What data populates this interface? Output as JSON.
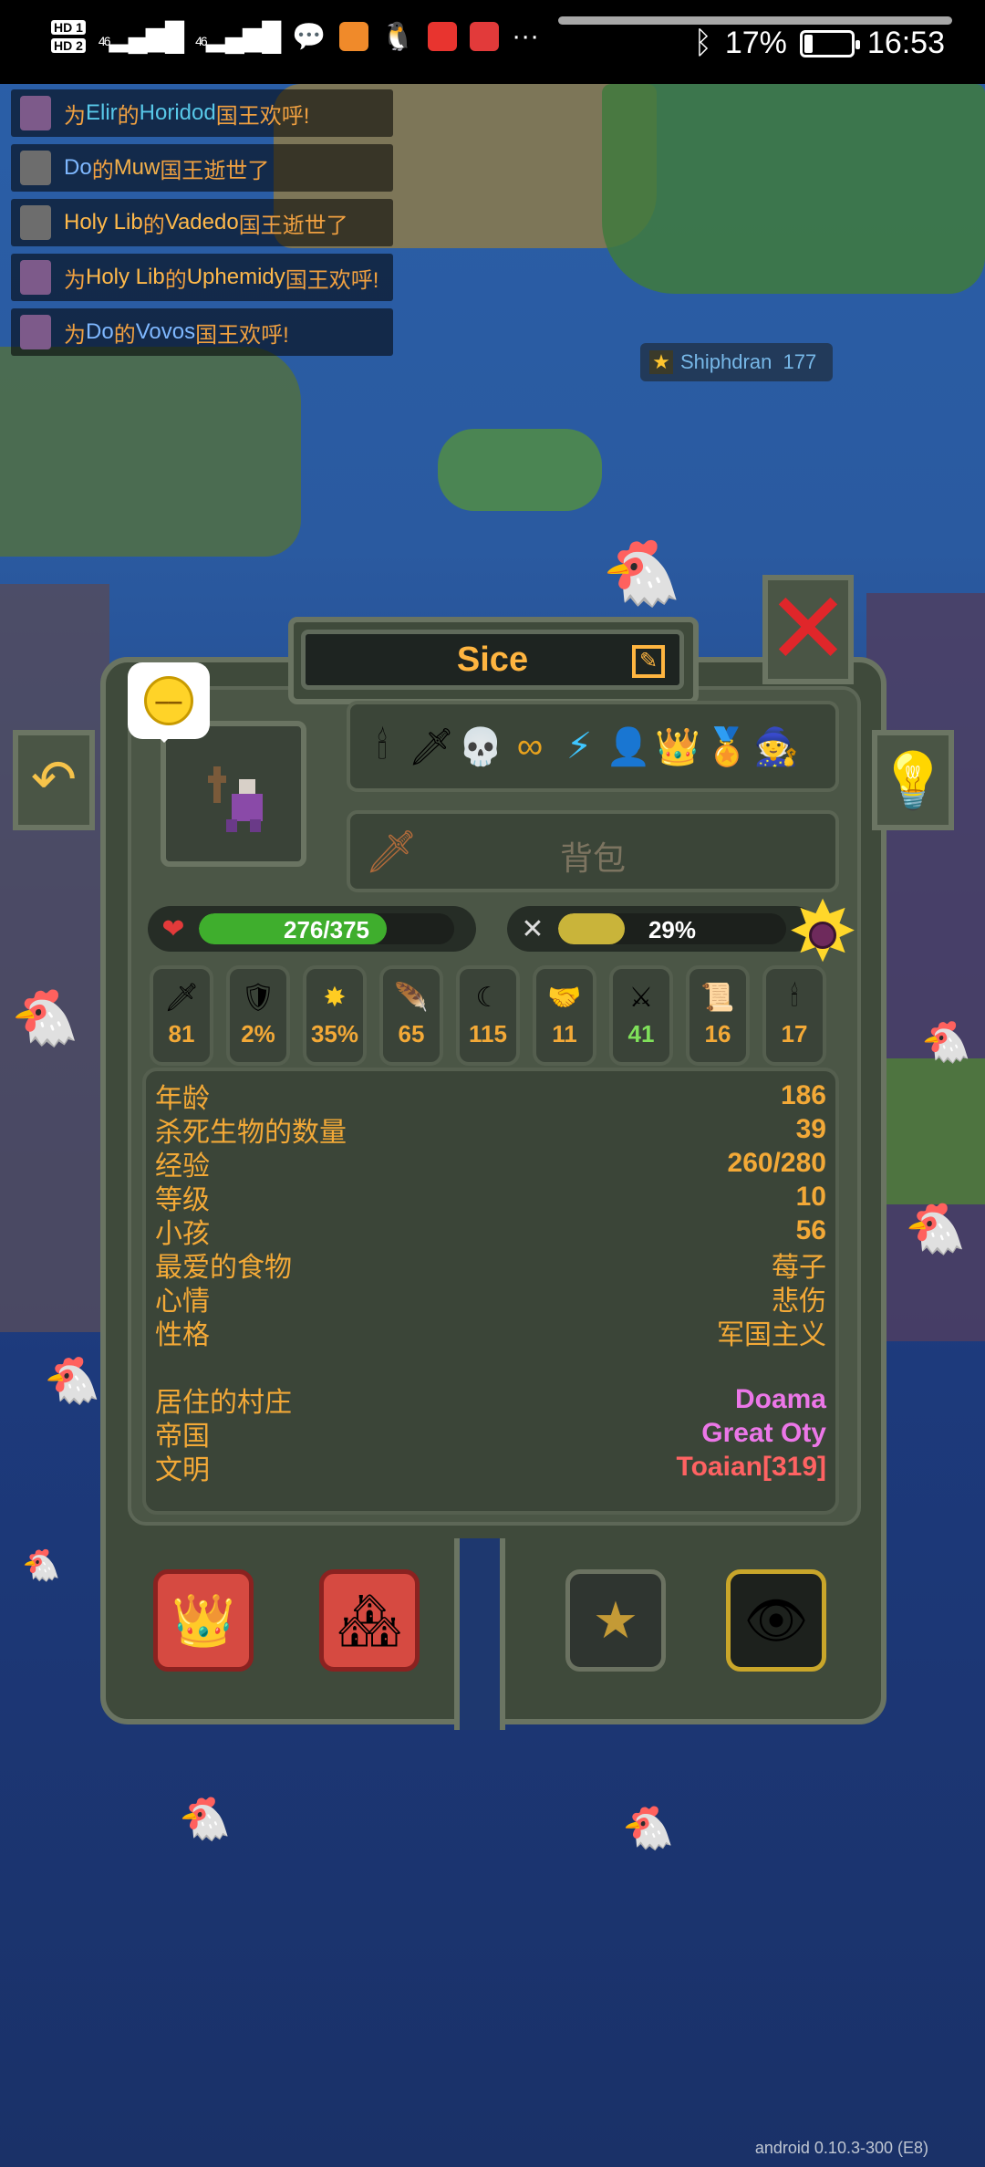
{
  "status_bar": {
    "hd_top": "HD 1",
    "hd_bottom": "HD 2",
    "signal1": "46",
    "signal2": "46",
    "more": "···",
    "battery_pct": "17%",
    "battery_level": 0.17,
    "time": "16:53"
  },
  "notifications": [
    {
      "parts": [
        "为 ",
        "Elir",
        " 的 ",
        "Horidod",
        " 国王欢呼!"
      ]
    },
    {
      "parts": [
        "",
        "Do",
        " 的 ",
        "Muw",
        " 国王逝世了"
      ]
    },
    {
      "parts": [
        "",
        "Holy Lib",
        " 的 ",
        "Vadedo",
        " 国王逝世了"
      ]
    },
    {
      "parts": [
        "为 ",
        "Holy Lib",
        " 的 ",
        "Uphemidy",
        " 国王欢呼!"
      ]
    },
    {
      "parts": [
        "为 ",
        "Do",
        " 的 ",
        "Vovos",
        " 国王欢呼!"
      ]
    }
  ],
  "map_tag": {
    "name": "Shiphdran",
    "count": "177"
  },
  "unit": {
    "name": "Sice",
    "bag_label": "背包",
    "health": "276/375",
    "health_level": 0.736,
    "hunger": "29%",
    "hunger_level": 0.29
  },
  "traits": [
    "candle-icon",
    "dagger-icon",
    "skull-icon",
    "infinity-icon",
    "lightning-icon",
    "head-icon",
    "crown-face-icon",
    "medal-icon",
    "wizard-hat-icon"
  ],
  "stats": [
    {
      "icon": "attack-icon",
      "value": "81"
    },
    {
      "icon": "armor-icon",
      "value": "2%"
    },
    {
      "icon": "crit-icon",
      "value": "35%"
    },
    {
      "icon": "speed-icon",
      "value": "65"
    },
    {
      "icon": "range-icon",
      "value": "115"
    },
    {
      "icon": "diplomacy-icon",
      "value": "11"
    },
    {
      "icon": "warfare-icon",
      "value": "41"
    },
    {
      "icon": "stewardship-icon",
      "value": "16"
    },
    {
      "icon": "intelligence-icon",
      "value": "17"
    }
  ],
  "info": [
    {
      "key": "年龄",
      "value": "186"
    },
    {
      "key": "杀死生物的数量",
      "value": "39"
    },
    {
      "key": "经验",
      "value": "260/280"
    },
    {
      "key": "等级",
      "value": "10"
    },
    {
      "key": "小孩",
      "value": "56"
    },
    {
      "key": "最爱的食物",
      "value": "莓子"
    },
    {
      "key": "心情",
      "value": "悲伤"
    },
    {
      "key": "性格",
      "value": "军国主义"
    }
  ],
  "info2": [
    {
      "key": "居住的村庄",
      "value": "Doama"
    },
    {
      "key": "帝国",
      "value": "Great Oty"
    },
    {
      "key": "文明",
      "value": "Toaian[319]"
    }
  ],
  "version": "android 0.10.3-300 (E8)"
}
